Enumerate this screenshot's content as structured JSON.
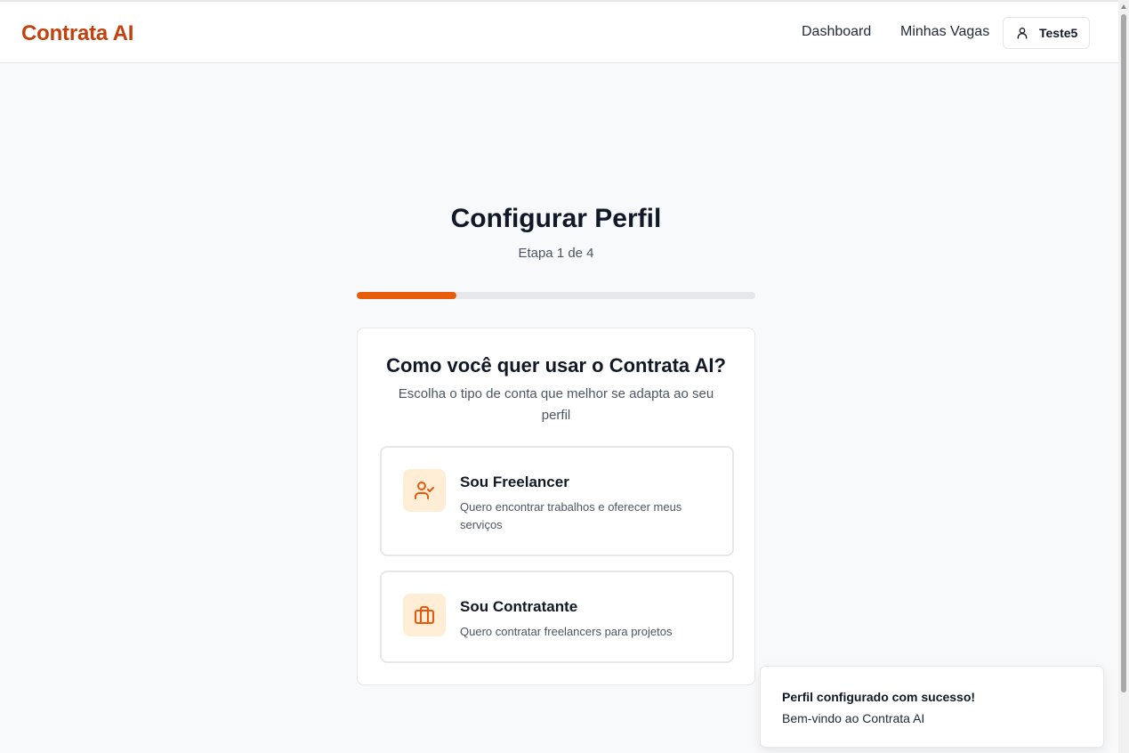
{
  "header": {
    "brand": "Contrata AI",
    "nav": {
      "dashboard": "Dashboard",
      "vagas": "Minhas Vagas"
    },
    "user": {
      "name": "Teste5",
      "icon": "user-icon"
    }
  },
  "main": {
    "title": "Configurar Perfil",
    "step": "Etapa 1 de 4",
    "progress_fraction": 0.25,
    "card": {
      "title": "Como você quer usar o Contrata AI?",
      "subtitle": "Escolha o tipo de conta que melhor se adapta ao seu perfil",
      "options": [
        {
          "title": "Sou Freelancer",
          "description": "Quero encontrar trabalhos e oferecer meus serviços",
          "icon": "user-check-icon"
        },
        {
          "title": "Sou Contratante",
          "description": "Quero contratar freelancers para projetos",
          "icon": "briefcase-icon"
        }
      ]
    }
  },
  "toast": {
    "title": "Perfil configurado com sucesso!",
    "description": "Bem-vindo ao Contrata AI"
  },
  "colors": {
    "brand": "#c2410c",
    "accent": "#e85d0c",
    "icon_bg": "#ffedd5"
  }
}
